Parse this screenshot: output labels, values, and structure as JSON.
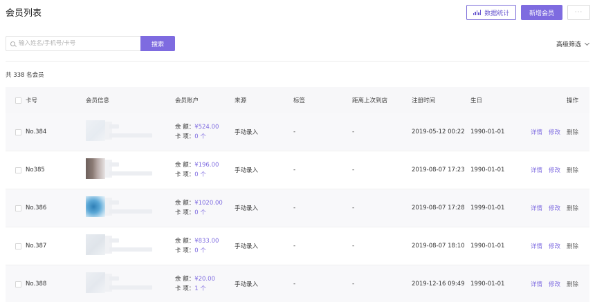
{
  "header": {
    "title": "会员列表",
    "stats_label": "数据统计",
    "add_label": "新增会员",
    "more_label": "···"
  },
  "search": {
    "placeholder": "输入姓名/手机号/卡号",
    "button_label": "搜索",
    "advanced_label": "高级筛选"
  },
  "summary": {
    "total_text": "共 338 名会员"
  },
  "colors": {
    "accent": "#7e6be0",
    "row_alt": "#f8f8fa",
    "header_bg": "#f7f7f9"
  },
  "table": {
    "columns": [
      "卡号",
      "会员信息",
      "会员账户",
      "来源",
      "标签",
      "距离上次到店",
      "注册时间",
      "生日",
      "操作"
    ],
    "balance_label": "余 额：",
    "items_label": "卡 项：",
    "actions": {
      "detail": "详情",
      "edit": "修改",
      "delete": "删除"
    },
    "rows": [
      {
        "card": "No.384",
        "balance": "¥524.00",
        "items": "0 个",
        "source": "手动录入",
        "tag": "-",
        "last_visit": "-",
        "registered": "2019-05-12 00:22",
        "birthday": "1990-01-01"
      },
      {
        "card": "No385",
        "balance": "¥196.00",
        "items": "0 个",
        "source": "手动录入",
        "tag": "-",
        "last_visit": "-",
        "registered": "2019-08-07 17:23",
        "birthday": "1990-01-01"
      },
      {
        "card": "No.386",
        "balance": "¥1020.00",
        "items": "0 个",
        "source": "手动录入",
        "tag": "-",
        "last_visit": "-",
        "registered": "2019-08-07 17:28",
        "birthday": "1999-01-01"
      },
      {
        "card": "No.387",
        "balance": "¥833.00",
        "items": "0 个",
        "source": "手动录入",
        "tag": "-",
        "last_visit": "-",
        "registered": "2019-08-07 18:10",
        "birthday": "1990-01-01"
      },
      {
        "card": "No.388",
        "balance": "¥20.00",
        "items": "1 个",
        "source": "手动录入",
        "tag": "-",
        "last_visit": "-",
        "registered": "2019-12-16 09:49",
        "birthday": "1990-01-01"
      }
    ]
  }
}
